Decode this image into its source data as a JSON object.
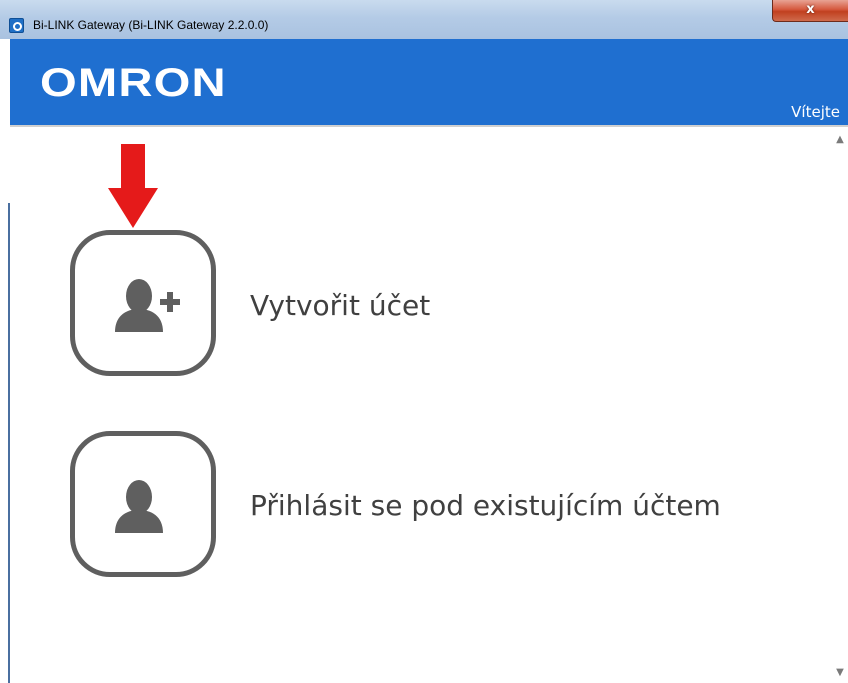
{
  "window": {
    "title": "Bi-LINK Gateway (Bi-LINK Gateway 2.2.0.0)",
    "close_label": "x",
    "icon": "app-icon"
  },
  "header": {
    "brand": "OMRON",
    "welcome": "Vítejte"
  },
  "actions": {
    "create_account": {
      "label": "Vytvořit účet",
      "icon": "add-user-icon"
    },
    "login_existing": {
      "label": "Přihlásit se pod existujícím účtem",
      "icon": "user-icon"
    }
  },
  "annotation": {
    "icon": "down-arrow-icon",
    "color": "#e51a1a"
  },
  "scrollbar": {
    "up": "▲",
    "down": "▼"
  }
}
